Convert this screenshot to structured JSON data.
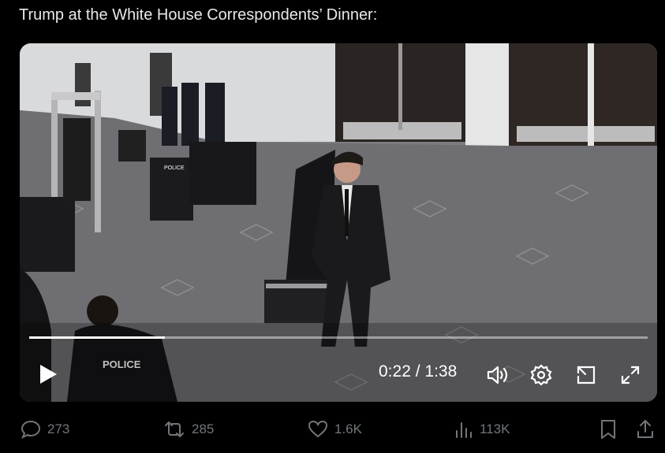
{
  "post": {
    "text": "Trump at the White House Correspondents’ Dinner:"
  },
  "video": {
    "current_time": "0:22",
    "separator": " / ",
    "duration": "1:38",
    "progress": 0.22,
    "scene_labels": {
      "vest_front": "POLICE",
      "vest_back": "POLICE"
    },
    "controls": [
      "play-icon",
      "volume-icon",
      "settings-icon",
      "pip-icon",
      "fullscreen-icon"
    ]
  },
  "actions": {
    "replies": "273",
    "reposts": "285",
    "likes": "1.6K",
    "views": "113K"
  },
  "colors": {
    "muted": "#71767b",
    "text": "#e7e9ea",
    "background": "#000000"
  }
}
